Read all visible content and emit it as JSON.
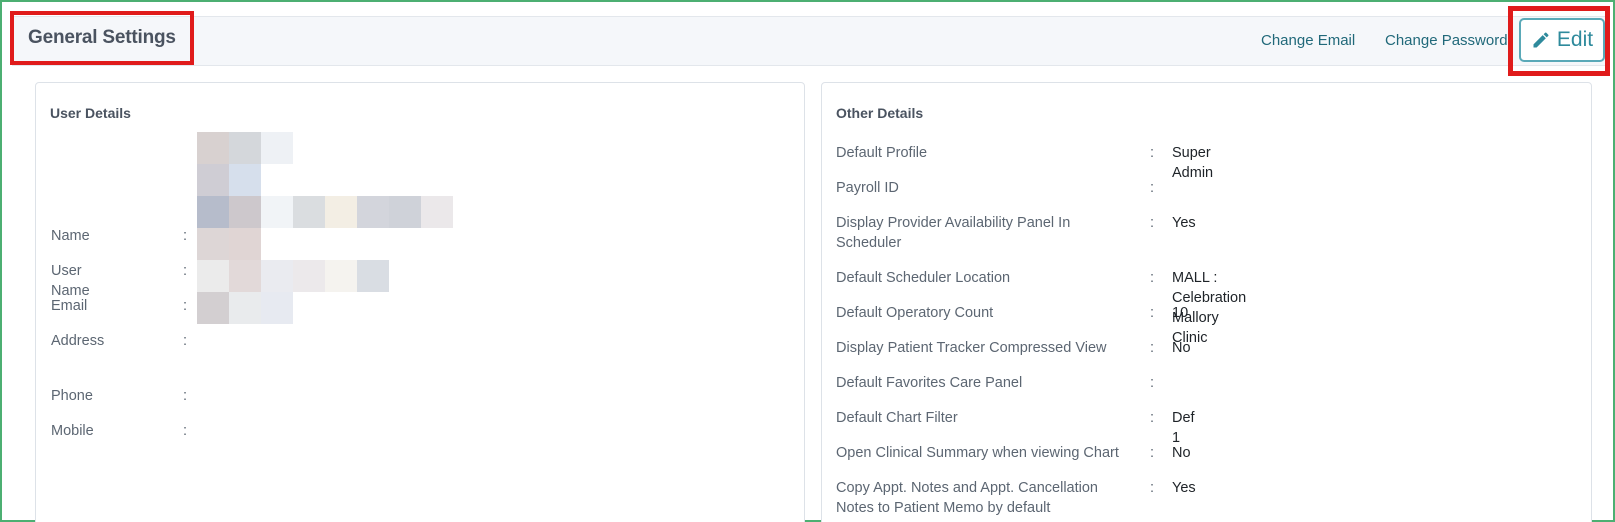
{
  "header": {
    "title": "General Settings",
    "change_email": "Change Email",
    "change_password": "Change Password",
    "edit_label": "Edit"
  },
  "user_details": {
    "title": "User Details",
    "fields": [
      {
        "label": "Name"
      },
      {
        "label": "User Name"
      },
      {
        "label": "Email"
      },
      {
        "label": "Address"
      },
      {
        "label": "Phone"
      },
      {
        "label": "Mobile"
      }
    ]
  },
  "other_details": {
    "title": "Other Details",
    "fields": [
      {
        "label": "Default Profile",
        "value": "Super Admin"
      },
      {
        "label": "Payroll ID",
        "value": ""
      },
      {
        "label": "Display Provider Availability Panel In Scheduler",
        "value": "Yes"
      },
      {
        "label": "Default Scheduler Location",
        "value": "MALL : Celebration Mallory Clinic"
      },
      {
        "label": "Default Operatory Count",
        "value": "10"
      },
      {
        "label": "Display Patient Tracker Compressed View",
        "value": "No"
      },
      {
        "label": "Default Favorites Care Panel",
        "value": ""
      },
      {
        "label": "Default Chart Filter",
        "value": "Def 1"
      },
      {
        "label": "Open Clinical Summary when viewing Chart",
        "value": "No"
      },
      {
        "label": "Copy Appt. Notes and Appt. Cancellation Notes to Patient Memo by default",
        "value": "Yes"
      }
    ]
  },
  "colors": {
    "accent": "#2e8a9c",
    "link": "#21697a",
    "highlight": "#e01b1b"
  }
}
